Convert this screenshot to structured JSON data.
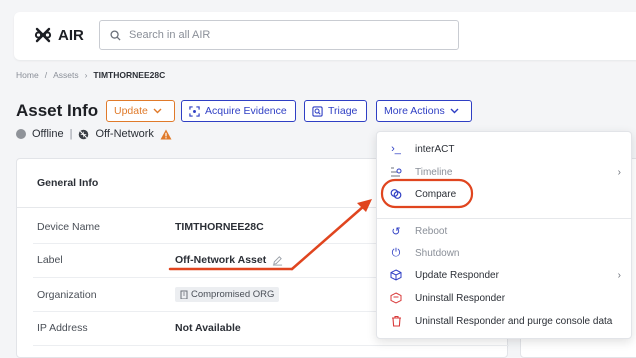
{
  "app": {
    "name": "AIR"
  },
  "search": {
    "placeholder": "Search in all AIR"
  },
  "breadcrumb": {
    "items": [
      "Home",
      "Assets"
    ],
    "current": "TIMTHORNEE28C"
  },
  "page": {
    "title": "Asset Info"
  },
  "toolbar": {
    "update_label": "Update",
    "acquire_label": "Acquire Evidence",
    "triage_label": "Triage",
    "more_label": "More Actions"
  },
  "status": {
    "online": "Offline",
    "network": "Off-Network"
  },
  "general_info": {
    "title": "General Info",
    "rows": [
      {
        "key": "Device Name",
        "value": "TIMTHORNEE28C"
      },
      {
        "key": "Label",
        "value": "Off-Network Asset"
      },
      {
        "key": "Organization",
        "value": "Compromised ORG"
      },
      {
        "key": "IP Address",
        "value": "Not Available"
      }
    ]
  },
  "menu": {
    "items": [
      {
        "label": "interACT",
        "icon": "terminal-icon",
        "enabled": true
      },
      {
        "label": "Timeline",
        "icon": "timeline-icon",
        "enabled": false
      },
      {
        "label": "Compare",
        "icon": "compare-icon",
        "enabled": true
      },
      {
        "label": "Reboot",
        "icon": "reboot-icon",
        "enabled": false
      },
      {
        "label": "Shutdown",
        "icon": "power-icon",
        "enabled": false
      },
      {
        "label": "Update Responder",
        "icon": "package-icon",
        "enabled": true
      },
      {
        "label": "Uninstall Responder",
        "icon": "uninstall-icon",
        "enabled": true
      },
      {
        "label": "Uninstall Responder and purge console data",
        "icon": "trash-icon",
        "enabled": true
      }
    ]
  },
  "colors": {
    "accent": "#2f3fc4",
    "orange": "#e07a2a",
    "annotation": "#e0451f",
    "danger": "#d93a3a"
  }
}
